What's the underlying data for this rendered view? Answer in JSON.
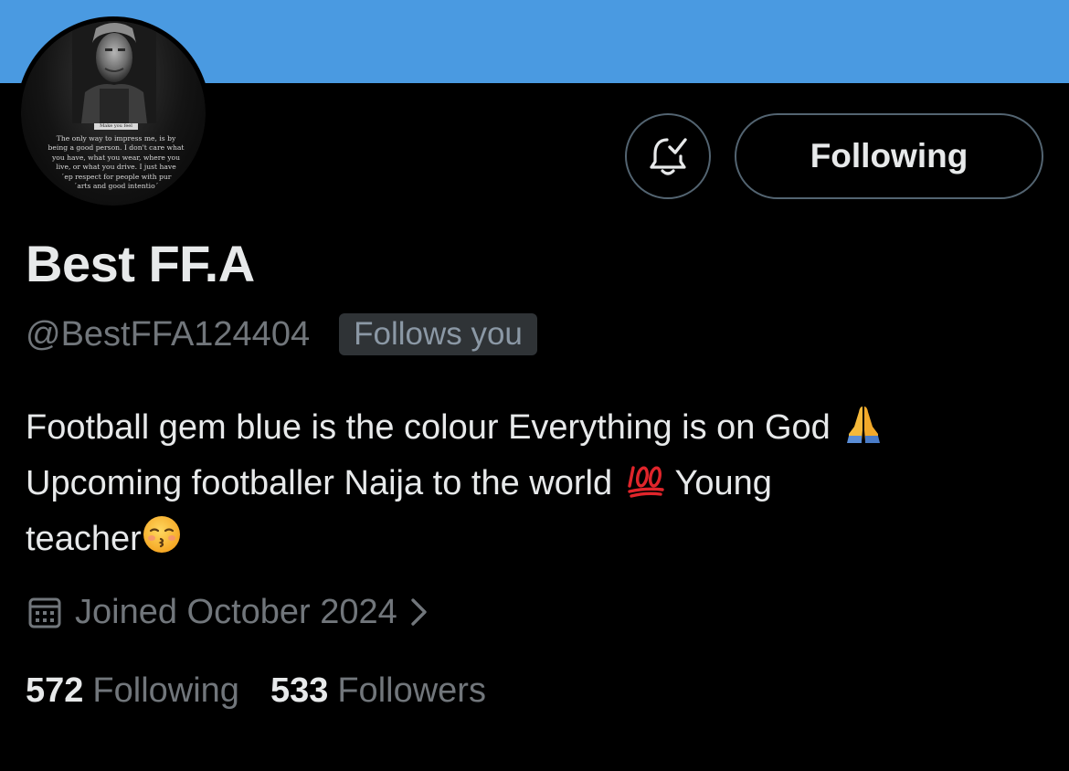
{
  "colors": {
    "banner": "#4a9ae1",
    "background": "#000000",
    "primary_text": "#e7e9ea",
    "secondary_text": "#71767b",
    "button_border": "#536471",
    "badge_bg": "#2f3336"
  },
  "avatar": {
    "icon": "profile-picture",
    "caption_banner": "Make you feel better",
    "caption": "The only way to impress me, is by\nbeing a good person. I don't care what\nyou have, what you wear, where you\nlive, or what you drive. I just have\n´ep respect for people with pur\n´arts and good intentio´"
  },
  "actions": {
    "notification_icon": "bell-check-icon",
    "follow_label": "Following"
  },
  "profile": {
    "display_name": "Best FF.A",
    "handle": "@BestFFA124404",
    "follows_badge": "Follows you",
    "bio": {
      "line1": "Football gem blue is the colour Everything is on God",
      "line1_emoji": "folded-hands",
      "line2_a": "Upcoming footballer Naija to the world",
      "line2_emoji": "hundred-points",
      "line2_b": "Young",
      "line3": "teacher",
      "line3_emoji": "kissing-face-closed-eyes"
    },
    "joined": "Joined October 2024",
    "following_count": "572",
    "following_label": "Following",
    "followers_count": "533",
    "followers_label": "Followers"
  }
}
